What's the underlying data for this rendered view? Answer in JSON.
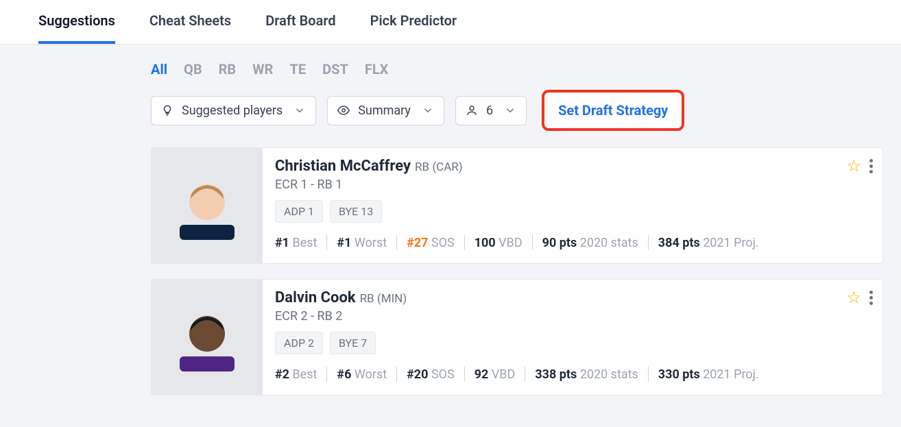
{
  "tabs": {
    "items": [
      "Suggestions",
      "Cheat Sheets",
      "Draft Board",
      "Pick Predictor"
    ],
    "activeIndex": 0
  },
  "posFilters": {
    "items": [
      "All",
      "QB",
      "RB",
      "WR",
      "TE",
      "DST",
      "FLX"
    ],
    "activeIndex": 0
  },
  "controls": {
    "suggested": "Suggested players",
    "summary": "Summary",
    "count": "6",
    "strategy": "Set Draft Strategy"
  },
  "players": [
    {
      "name": "Christian McCaffrey",
      "pos": "RB (CAR)",
      "ecr": "ECR 1 - RB 1",
      "badges": [
        "ADP 1",
        "BYE 13"
      ],
      "bestRank": "#1",
      "bestLbl": "Best",
      "worstRank": "#1",
      "worstLbl": "Worst",
      "sosRank": "#27",
      "sosLbl": "SOS",
      "sosOrange": true,
      "vbd": "100",
      "vbdLbl": "VBD",
      "prevPts": "90 pts",
      "prevLbl": "2020 stats",
      "projPts": "384 pts",
      "projLbl": "2021 Proj.",
      "skin": "#f3cdb2",
      "hair": "#bb8a58",
      "jersey": "#0d2340"
    },
    {
      "name": "Dalvin Cook",
      "pos": "RB (MIN)",
      "ecr": "ECR 2 - RB 2",
      "badges": [
        "ADP 2",
        "BYE 7"
      ],
      "bestRank": "#2",
      "bestLbl": "Best",
      "worstRank": "#6",
      "worstLbl": "Worst",
      "sosRank": "#20",
      "sosLbl": "SOS",
      "sosOrange": false,
      "vbd": "92",
      "vbdLbl": "VBD",
      "prevPts": "338 pts",
      "prevLbl": "2020 stats",
      "projPts": "330 pts",
      "projLbl": "2021 Proj.",
      "skin": "#6b4a34",
      "hair": "#1a1a1a",
      "jersey": "#4F2683"
    }
  ]
}
